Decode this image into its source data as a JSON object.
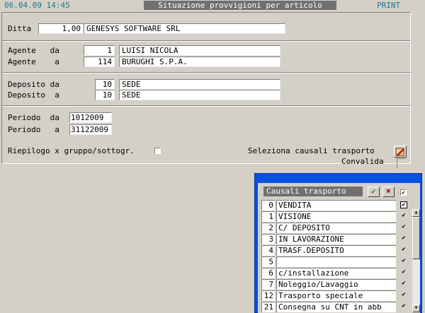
{
  "header": {
    "datetime": "06.04.09 14:45",
    "title": "Situazione provvigioni per articolo",
    "print_label": "PRINT"
  },
  "form": {
    "ditta_label": "Ditta",
    "ditta_code": "1,00",
    "ditta_name": "GENESYS SOFTWARE SRL",
    "agente_da_label": "Agente   da",
    "agente_da_code": "1",
    "agente_da_name": "LUISI NICOLA",
    "agente_a_label": "Agente    a",
    "agente_a_code": "114",
    "agente_a_name": "BURUGHI S.P.A.",
    "deposito_da_label": "Deposito da",
    "deposito_da_code": "10",
    "deposito_da_name": "SEDE",
    "deposito_a_label": "Deposito  a",
    "deposito_a_code": "10",
    "deposito_a_name": "SEDE",
    "periodo_da_label": "Periodo  da",
    "periodo_da_value": "1012009",
    "periodo_a_label": "Periodo   a",
    "periodo_a_value": "31122009",
    "riepilogo_label": "Riepilogo x gruppo/sottogr.",
    "seleziona_label": "Seleziona causali trasporto",
    "convalida_label": "Convalida"
  },
  "popup": {
    "title": "Causali trasporto",
    "header_checked": "✔",
    "rows": [
      {
        "code": "0",
        "desc": "VENDITA",
        "checked": "✔"
      },
      {
        "code": "1",
        "desc": "VISIONE",
        "checked": "✔"
      },
      {
        "code": "2",
        "desc": "C/ DEPOSITO",
        "checked": "✔"
      },
      {
        "code": "3",
        "desc": "IN LAVORAZIONE",
        "checked": "✔"
      },
      {
        "code": "4",
        "desc": "TRASF.DEPOSITO",
        "checked": "✔"
      },
      {
        "code": "5",
        "desc": "",
        "checked": "✔"
      },
      {
        "code": "6",
        "desc": "c/installazione",
        "checked": "✔"
      },
      {
        "code": "7",
        "desc": "Noleggio/Lavaggio",
        "checked": "✔"
      },
      {
        "code": "12",
        "desc": "Trasporto speciale",
        "checked": "✔"
      },
      {
        "code": "21",
        "desc": "Consegna su CNT in abb",
        "checked": "✔"
      }
    ]
  }
}
